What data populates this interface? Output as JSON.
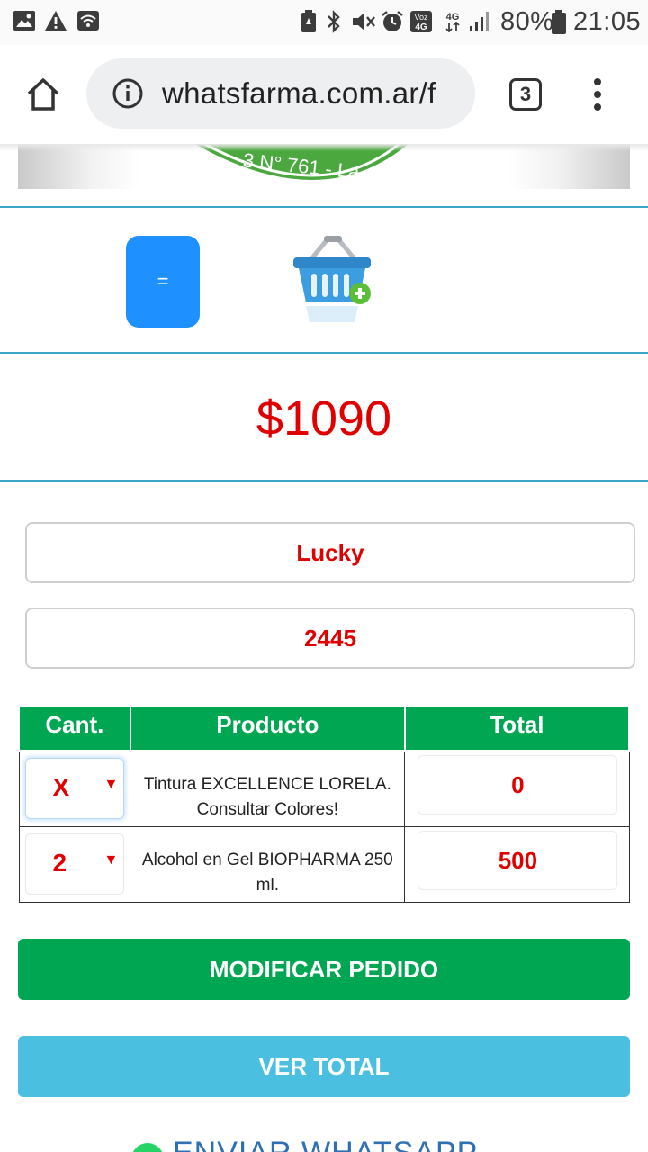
{
  "status_bar": {
    "battery": "80%",
    "time": "21:05",
    "network": "4G",
    "volte_badge": "Voz 4G",
    "icons": [
      "image-icon",
      "warning-icon",
      "wifi-icon",
      "battery-saver-icon",
      "bluetooth-icon",
      "mute-icon",
      "alarm-icon",
      "signal-icon",
      "battery-icon"
    ]
  },
  "browser": {
    "url": "whatsfarma.com.ar/f",
    "tab_count": "3",
    "icons": [
      "home-icon",
      "info-icon",
      "more-vert-icon"
    ]
  },
  "logo": {
    "visible_text": "3 N° 761 - La"
  },
  "actions": {
    "equals_label": "=",
    "basket_icon": "add-to-basket-icon"
  },
  "order": {
    "price": "$1090",
    "customer_name": "Lucky",
    "customer_code": "2445"
  },
  "table": {
    "headers": [
      "Cant.",
      "Producto",
      "Total"
    ],
    "rows": [
      {
        "qty": "X",
        "product": "Tintura EXCELLENCE LORELA. Consultar Colores!",
        "total": "0"
      },
      {
        "qty": "2",
        "product": "Alcohol en Gel BIOPHARMA 250 ml.",
        "total": "500"
      }
    ]
  },
  "buttons": {
    "modify": "MODIFICAR PEDIDO",
    "view_total": "VER TOTAL",
    "send_whatsapp": "ENVIAR WHATSAPP"
  },
  "colors": {
    "price_red": "#e00000",
    "green": "#00a651",
    "light_blue": "#4bbfdf",
    "blue_button": "#1e90ff",
    "divider": "#3aa6c9"
  }
}
